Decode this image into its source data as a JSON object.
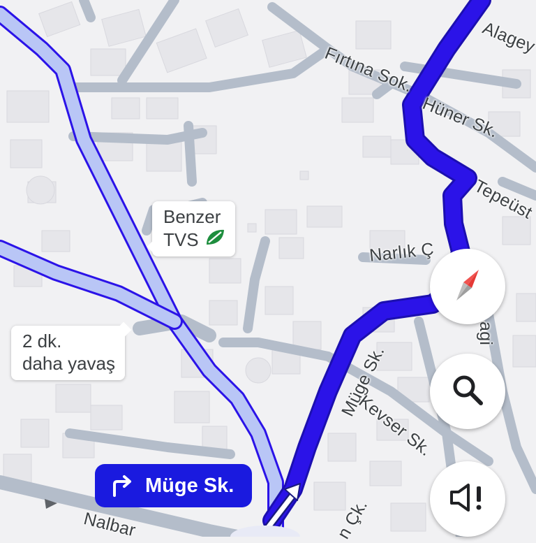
{
  "map": {
    "streets": [
      {
        "name": "Alagey"
      },
      {
        "name": "Fırtına Sok."
      },
      {
        "name": "Hüner Sk."
      },
      {
        "name": "Tepeüst"
      },
      {
        "name": "Narlık Ç"
      },
      {
        "name": "Müge Sk."
      },
      {
        "name": "Kevser Sk."
      },
      {
        "name": "Nalbar"
      },
      {
        "name": "agi"
      },
      {
        "name": "n Çk."
      }
    ],
    "place_callout": {
      "line1": "Benzer",
      "line2": "TVS",
      "icon": "leaf-icon",
      "icon_color": "#1e8e3e"
    },
    "alt_route_callout": {
      "line1": "2 dk.",
      "line2": "daha yavaş"
    }
  },
  "navigation": {
    "next_turn": {
      "direction": "turn-right-icon",
      "street": "Müge Sk."
    },
    "route_color": "#2b13e8",
    "alt_route_color": "#b9c6f6"
  },
  "controls": {
    "compass": "compass-icon",
    "search": "search-icon",
    "sound": "sound-alert-icon"
  }
}
